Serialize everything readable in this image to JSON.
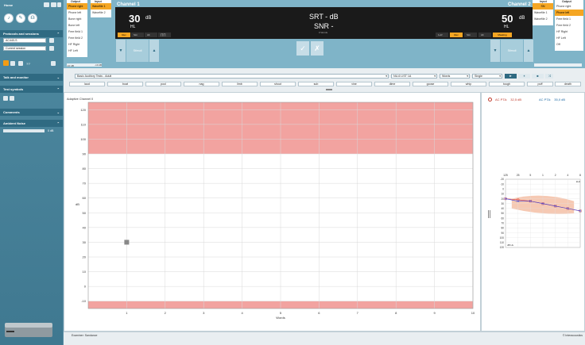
{
  "sidebar": {
    "home_label": "Home",
    "protocols_label": "Protocols and sessions",
    "protocol_value": "AC440-S",
    "session_value": "Current session",
    "level_text": "??'",
    "talk_monitor_label": "Talk and monitor",
    "test_symbols_label": "Test symbols",
    "comments_label": "Comments",
    "ambient_label": "Ambient Noise",
    "ambient_value": "0 dB"
  },
  "channel1": {
    "title": "Channel 1",
    "output_label": "Output",
    "input_label": "Input",
    "outputs": [
      "Phone right",
      "Phone left",
      "Bone right",
      "Bone left",
      "Free field 1",
      "Free field 2",
      "HF Right",
      "HF Left"
    ],
    "selected_output": "Phone right",
    "inputs": [
      "Wavefile 1",
      "Wavefile 2"
    ],
    "selected_input": "Wavefile 1",
    "level_value": "30",
    "level_unit": "dB",
    "level_type": "HL",
    "stimulus_label": "Stimuli",
    "level_min": "-10 dB",
    "level_max": "-10 dB",
    "mode_buttons": [
      "Rev",
      "Sim",
      "Alt"
    ]
  },
  "center": {
    "srt_label": "SRT - dB",
    "snr_label": "SNR -",
    "words_label": "0 Words"
  },
  "channel2": {
    "title": "Channel 2",
    "output_label": "Output",
    "input_label": "Input",
    "inputs": [
      "SN",
      "Wavefile 1",
      "Wavefile 2"
    ],
    "selected_input": "SN",
    "outputs": [
      "Phone right",
      "Phone left",
      "Free field 1",
      "Free field 2",
      "HF Right",
      "HF Left",
      "Off"
    ],
    "selected_output": "Phone left",
    "level_value": "50",
    "level_unit": "dB",
    "level_type": "HL",
    "stimulus_label": "Stimuli",
    "mode_buttons": [
      "1+R",
      "Rev",
      "Sim",
      "Alt",
      "Masking"
    ],
    "selected_mode": "Masking"
  },
  "word_controls": {
    "test_list": "Basic Auditory Tests - Adult",
    "word_list": "NU-6 LIST 1A",
    "score_mode": "Words",
    "presentation": "Single",
    "words": [
      "laud",
      "boat",
      "pool",
      "nag",
      "limb",
      "shout",
      "sub",
      "vine",
      "dime",
      "goose",
      "whip",
      "tough",
      "puff",
      "keen",
      "death",
      "sell"
    ]
  },
  "chart": {
    "title": "Adaptive Channel 0",
    "ylabel": "dB",
    "xlabel": "Words"
  },
  "chart_data": {
    "type": "scatter",
    "title": "Adaptive Channel 0",
    "xlabel": "Words",
    "ylabel": "dB",
    "x_ticks": [
      1,
      2,
      3,
      4,
      5,
      6,
      7,
      8,
      9,
      10
    ],
    "y_ticks": [
      120,
      110,
      100,
      90,
      80,
      70,
      60,
      50,
      40,
      30,
      20,
      10,
      0,
      -10
    ],
    "xlim": [
      0,
      10
    ],
    "ylim": [
      -15,
      125
    ],
    "shaded_bands": [
      [
        90,
        125
      ],
      [
        -15,
        -10
      ]
    ],
    "points": [
      {
        "x": 1,
        "y": 30
      }
    ]
  },
  "pta": {
    "ac_pta_right_label": "AC PTA:",
    "ac_pta_right_value": "32,5 dB",
    "ac_pta_left_label": "AC PTA:",
    "ac_pta_left_value": "35,0 dB"
  },
  "mini_audiogram": {
    "freq_labels": [
      "125",
      "25",
      "5",
      "1",
      "2",
      "4",
      "8"
    ],
    "khz": "kHz",
    "y_labels": [
      "-20",
      "-10",
      "0",
      "10",
      "20",
      "30",
      "40",
      "50",
      "60",
      "70",
      "80",
      "90",
      "100",
      "110",
      "120"
    ],
    "unit": "dB HL",
    "right_ear_color": "#e74c3c",
    "left_ear_color": "#3a3fd9",
    "right_ear": [
      20,
      22,
      25,
      30,
      35,
      40,
      45
    ],
    "left_ear": [
      20,
      25,
      25,
      30,
      35,
      40,
      45
    ]
  },
  "status": {
    "examiner": "Examiner: Sandance",
    "copyright": "© Interacoustics"
  },
  "colors": {
    "accent": "#f5a623",
    "band": "#f2a3a0",
    "sidebar": "#3f7890"
  }
}
